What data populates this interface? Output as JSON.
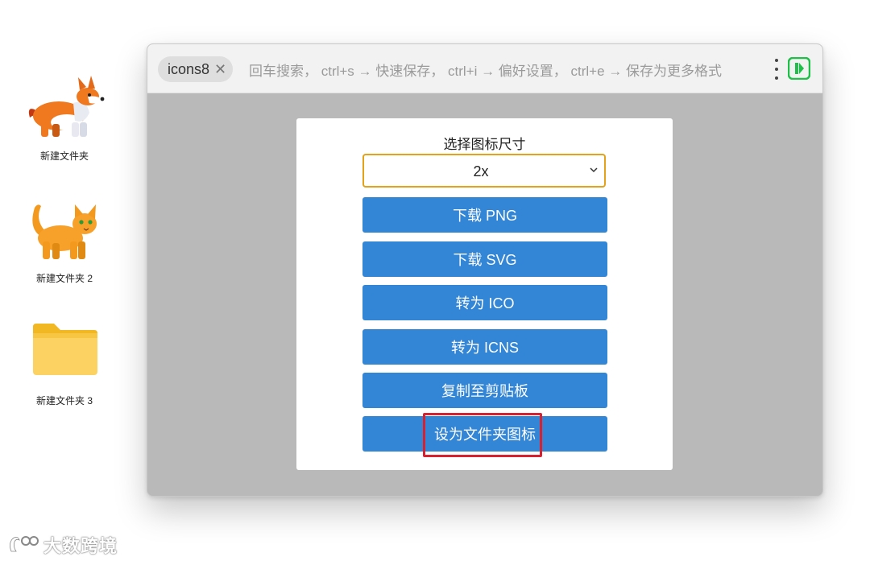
{
  "desktop": {
    "items": [
      {
        "label": "新建文件夹",
        "icon": "corgi-icon"
      },
      {
        "label": "新建文件夹 2",
        "icon": "cat-icon"
      },
      {
        "label": "新建文件夹 3",
        "icon": "folder-icon"
      }
    ]
  },
  "window": {
    "search_chip": "icons8",
    "close_glyph": "✕",
    "hint": "回车搜索， ctrl+s → 快速保存， ctrl+i → 偏好设置， ctrl+e → 保存为更多格式"
  },
  "panel": {
    "title": "选择图标尺寸",
    "size_select": {
      "value": "2x"
    },
    "buttons": {
      "download_png": "下载 PNG",
      "download_svg": "下载 SVG",
      "to_ico": "转为 ICO",
      "to_icns": "转为 ICNS",
      "copy": "复制至剪贴板",
      "set_folder_icon": "设为文件夹图标"
    }
  },
  "watermark": {
    "text": "大数跨境"
  },
  "colors": {
    "button_blue": "#3385d6",
    "select_border": "#e3a21a",
    "highlight_red": "#d9202f",
    "brand_green": "#1fbf4a"
  }
}
